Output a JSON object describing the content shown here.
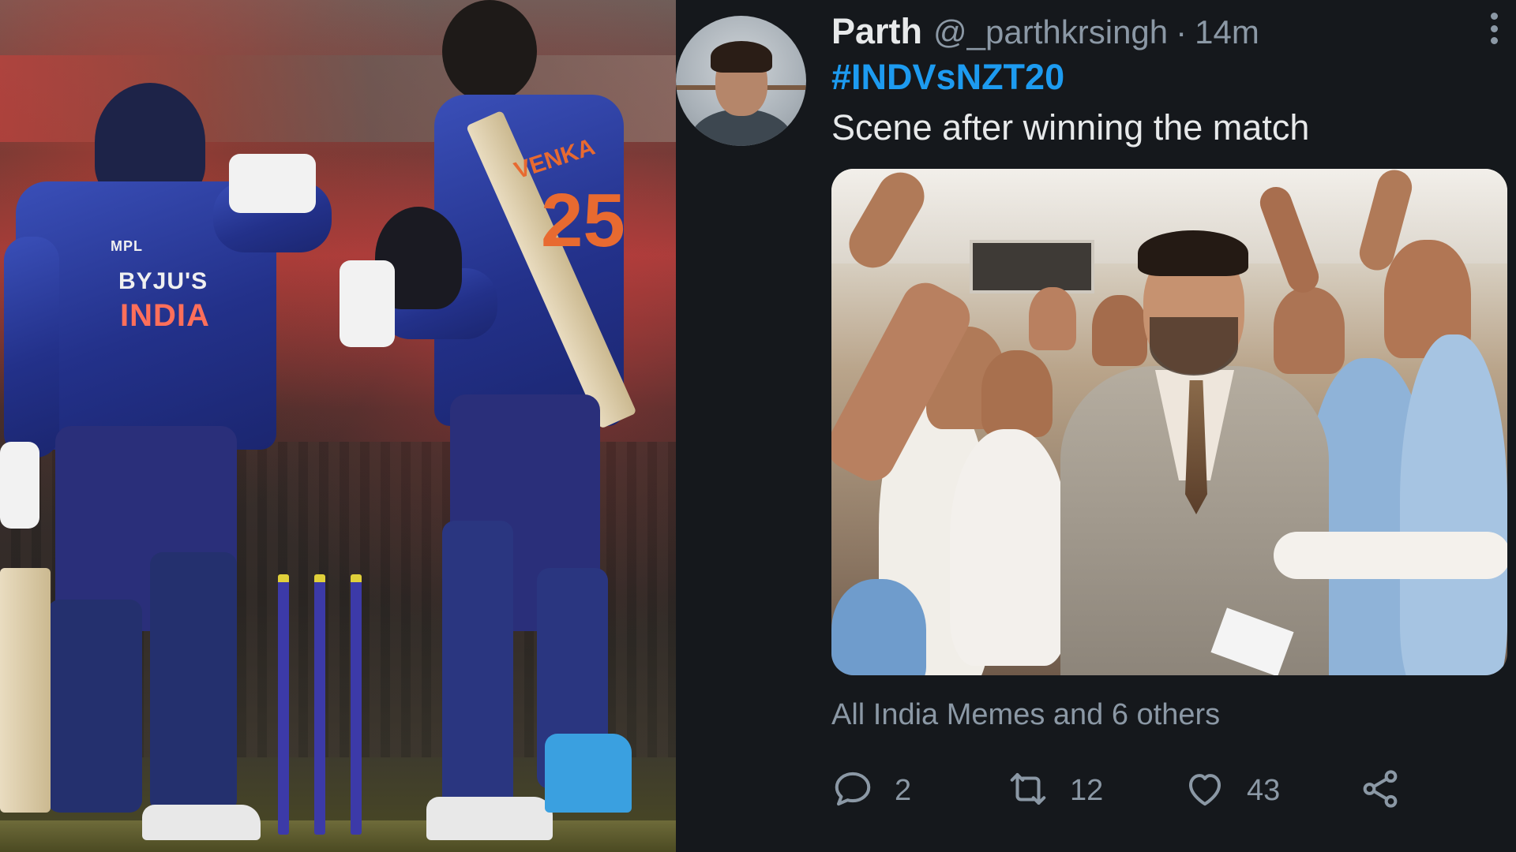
{
  "tweet": {
    "author": {
      "name": "Parth",
      "handle": "@_parthkrsingh",
      "separator": "·",
      "timestamp": "14m"
    },
    "hashtag": "#INDVsNZT20",
    "text": "Scene after winning the match",
    "social_context": "All India Memes and 6 others",
    "actions": {
      "reply": {
        "icon": "reply-icon",
        "count": "2"
      },
      "retweet": {
        "icon": "retweet-icon",
        "count": "12"
      },
      "like": {
        "icon": "heart-icon",
        "count": "43"
      },
      "share": {
        "icon": "share-icon"
      }
    }
  },
  "photo": {
    "jersey_sponsor": "BYJU'S",
    "jersey_team": "INDIA",
    "jersey_number": "25",
    "jersey_name": "VENKA",
    "jersey_brand": "MPL"
  },
  "colors": {
    "background": "#15181c",
    "text_primary": "#e7e9ea",
    "text_secondary": "#8b98a5",
    "accent": "#1d9bf0"
  }
}
